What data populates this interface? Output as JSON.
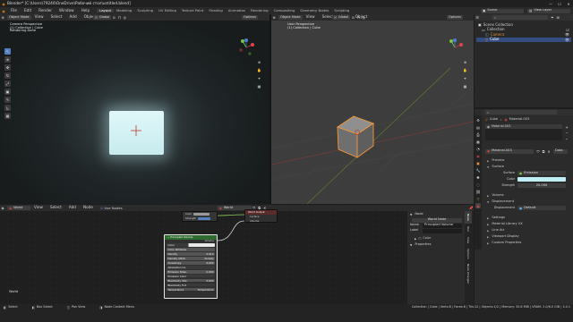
{
  "window": {
    "title": "Blender* [C:\\Users\\79240\\OneDrive\\Рабочий стол\\untitled.blend]",
    "controls": [
      "—",
      "☐",
      "✕"
    ]
  },
  "topbar": {
    "menus": [
      "File",
      "Edit",
      "Render",
      "Window",
      "Help"
    ],
    "tabs": [
      "Layout",
      "Modeling",
      "Sculpting",
      "UV Editing",
      "Texture Paint",
      "Shading",
      "Animation",
      "Rendering",
      "Compositing",
      "Geometry Nodes",
      "Scripting"
    ],
    "active_tab": "Layout",
    "scene_label": "Scene",
    "view_layer_label": "View Layer"
  },
  "left_viewport": {
    "mode": "Object Mode",
    "menus": [
      "View",
      "Select",
      "Add",
      "Object"
    ],
    "transform": "Global",
    "options": "Options",
    "overlay_lines": [
      "Camera Perspective",
      "(1) Collection | Cube",
      "Rendering Done"
    ],
    "tools": [
      "cursor",
      "select",
      "move",
      "rotate",
      "scale",
      "transform",
      "annotate",
      "measure",
      "add-cube"
    ]
  },
  "right_viewport": {
    "mode": "Object Mode",
    "menus": [
      "View",
      "Select",
      "Add",
      "Object"
    ],
    "transform": "Global",
    "options": "Options",
    "overlay_lines": [
      "User Perspective",
      "(1) Collection | Cube"
    ]
  },
  "outliner": {
    "items": [
      {
        "label": "Scene Collection",
        "indent": 0,
        "color": "#cccccc"
      },
      {
        "label": "Collection",
        "indent": 1,
        "color": "#cccccc"
      },
      {
        "label": "Camera",
        "indent": 2,
        "color": "#e0893a"
      },
      {
        "label": "Cube",
        "indent": 2,
        "color": "#e0893a"
      }
    ]
  },
  "properties": {
    "object_name": "Cube",
    "material_name": "Material.003",
    "slot_name": "Material.003",
    "data_label": "Data",
    "sections": {
      "preview": "Preview",
      "surface": "Surface",
      "volume": "Volume",
      "displacement": "Displacement",
      "settings": "Settings",
      "material_library": "Material Library VX",
      "line_art": "Line Art",
      "viewport_display": "Viewport Display",
      "custom_properties": "Custom Properties"
    },
    "surface_label": "Surface",
    "surface_value": "Emission",
    "color_label": "Color",
    "strength_label": "Strength",
    "strength_value": "20.000",
    "displacement_label": "Displacement",
    "displacement_value": "Default",
    "emission_color": "#bfeff5"
  },
  "node_editor": {
    "editor_type": "World",
    "menus": [
      "View",
      "Select",
      "Add",
      "Node"
    ],
    "use_nodes_label": "Use Nodes",
    "slot": "World",
    "world_label": "World",
    "output_node": {
      "label": "World Output",
      "rows": [
        "Surface",
        "Volume"
      ]
    },
    "background_node": {
      "rows": [
        "Color",
        "Strength"
      ]
    },
    "volume_node": {
      "title": "Principled Volume",
      "output": "Volume",
      "rows": [
        {
          "label": "Color",
          "value": ""
        },
        {
          "label": "Color Attribute",
          "value": ""
        },
        {
          "label": "Density",
          "value": "0.010"
        },
        {
          "label": "Density Attrib.",
          "value": "density"
        },
        {
          "label": "Anisotropy",
          "value": "0.000"
        },
        {
          "label": "Absorption Co.",
          "value": ""
        },
        {
          "label": "Emission Stren.",
          "value": "0.000"
        },
        {
          "label": "Emission Color",
          "value": ""
        },
        {
          "label": "Blackbody Inte.",
          "value": "0.000"
        },
        {
          "label": "Blackbody Tint",
          "value": ""
        },
        {
          "label": "Temperature",
          "value": "Temperature"
        }
      ]
    },
    "sidebar": {
      "title": "Node",
      "name_field": "World Node",
      "name_label": "Name",
      "name_value": "Principled Volume",
      "label_label": "Label",
      "color_label": "Color",
      "properties_label": "Properties",
      "tabs": [
        "Node",
        "Tool",
        "View",
        "Options",
        "Node Wrangler"
      ]
    }
  },
  "statusbar": {
    "items": [
      "Select",
      "Box Select",
      "Pan View",
      "Node Context Menu"
    ],
    "stats": "Collection | Cube | Verts:8 | Faces:6 | Tris:12 | Objects:1/2 | Memory: 35.8 MiB | VRAM: 2.0/6.0 GiB | 3.4.1"
  }
}
